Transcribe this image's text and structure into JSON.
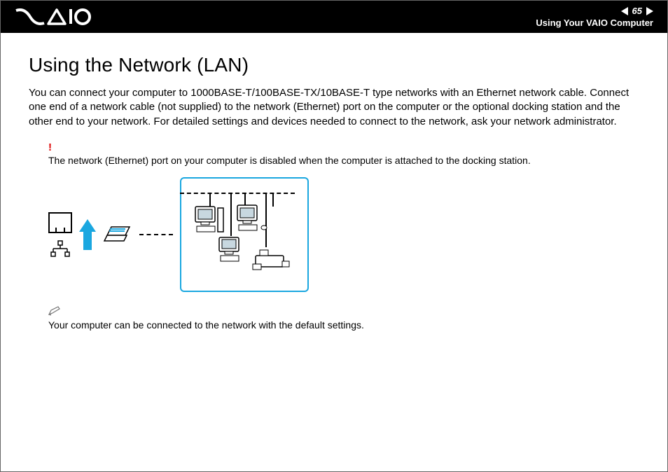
{
  "header": {
    "page_number": "65",
    "section": "Using Your VAIO Computer"
  },
  "main": {
    "heading": "Using the Network (LAN)",
    "lead": "You can connect your computer to 1000BASE-T/100BASE-TX/10BASE-T type networks with an Ethernet network cable. Connect one end of a network cable (not supplied) to the network (Ethernet) port on the computer or the optional docking station and the other end to your network. For detailed settings and devices needed to connect to the network, ask your network administrator.",
    "warning_symbol": "!",
    "warning_text": "The network (Ethernet) port on your computer is disabled when the computer is attached to the docking station.",
    "tip_text": "Your computer can be connected to the network with the default settings."
  }
}
